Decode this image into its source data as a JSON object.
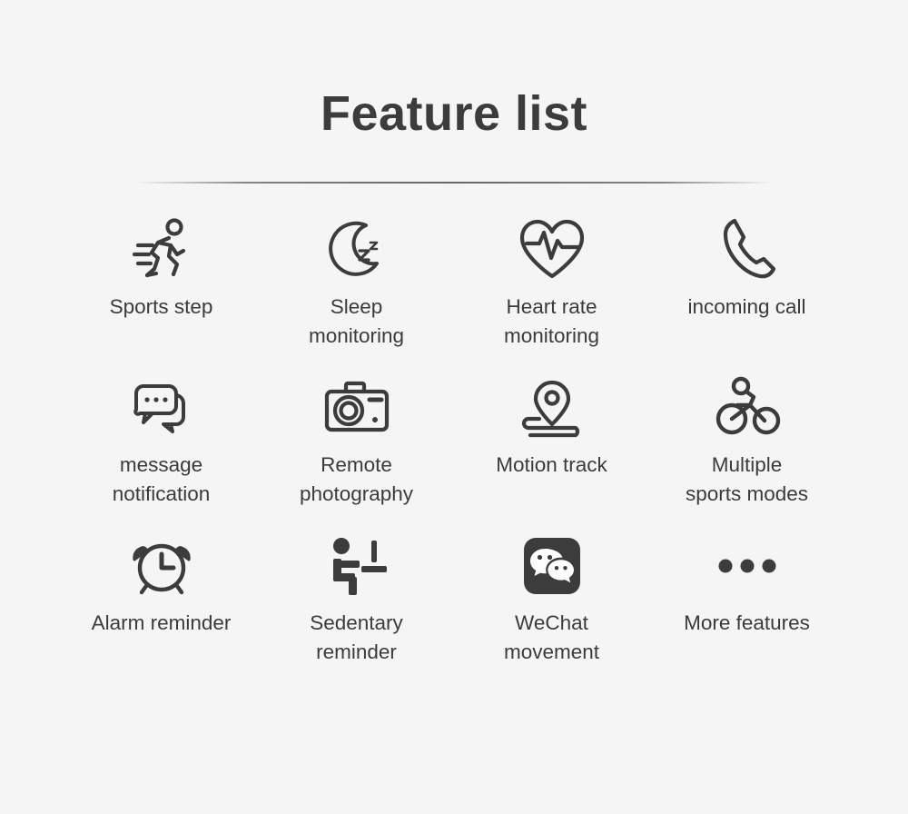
{
  "header": {
    "title": "Feature list"
  },
  "divider": {
    "present": true
  },
  "colors": {
    "background": "#f5f5f5",
    "title_text": "#3c3c3c",
    "label_text": "#3b3b3b",
    "icon_stroke": "#3c3c3c",
    "wechat_badge_bg": "#3c3c3c",
    "wechat_bubble": "#ffffff"
  },
  "features": [
    {
      "icon": "running-person-icon",
      "label": "Sports step"
    },
    {
      "icon": "crescent-moon-zzz-icon",
      "label": "Sleep\nmonitoring"
    },
    {
      "icon": "heart-pulse-icon",
      "label": "Heart rate\nmonitoring"
    },
    {
      "icon": "phone-handset-icon",
      "label": "incoming call"
    },
    {
      "icon": "speech-bubbles-icon",
      "label": "message\nnotification"
    },
    {
      "icon": "camera-icon",
      "label": "Remote\nphotography"
    },
    {
      "icon": "map-pin-path-icon",
      "label": "Motion track"
    },
    {
      "icon": "bicycle-rider-icon",
      "label": "Multiple\nsports modes"
    },
    {
      "icon": "alarm-clock-icon",
      "label": "Alarm reminder"
    },
    {
      "icon": "sitting-person-desk-icon",
      "label": "Sedentary\nreminder"
    },
    {
      "icon": "wechat-icon",
      "label": "WeChat\nmovement"
    },
    {
      "icon": "ellipsis-dots-icon",
      "label": "More features"
    }
  ]
}
